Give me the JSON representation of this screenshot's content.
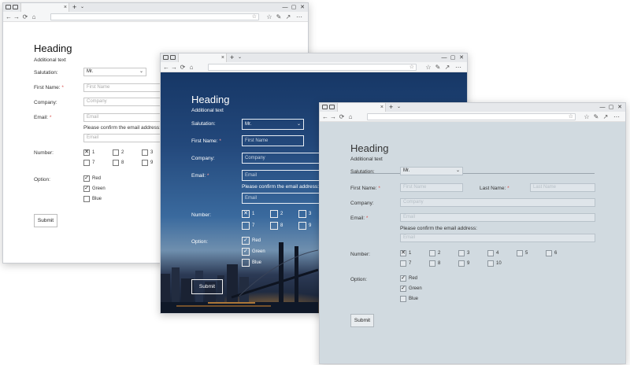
{
  "browser": {
    "tab_close": "×",
    "new_tab": "+",
    "tab_menu": "⌄",
    "window_controls": [
      "—",
      "▢",
      "✕"
    ],
    "nav_icons": [
      "←",
      "→",
      "⟳",
      "⌂"
    ],
    "address_icons": [
      "☆",
      "⋯"
    ]
  },
  "forms": [
    {
      "theme": "default",
      "heading": "Heading",
      "additional": "Additional text",
      "salutation_label": "Salutation:",
      "salutation_value": "Mr.",
      "first_name_label": "First Name:",
      "first_name_placeholder": "First Name",
      "company_label": "Company:",
      "company_placeholder": "Company",
      "email_label": "Email:",
      "email_placeholder": "Email",
      "confirm_label": "Please confirm the email address:",
      "confirm_placeholder": "Email",
      "number_label": "Number:",
      "numbers": [
        {
          "label": "1",
          "checked": true
        },
        {
          "label": "2",
          "checked": false
        },
        {
          "label": "3",
          "checked": false
        },
        {
          "label": "7",
          "checked": false
        },
        {
          "label": "8",
          "checked": false
        },
        {
          "label": "9",
          "checked": false
        }
      ],
      "option_label": "Option:",
      "options": [
        {
          "label": "Red",
          "checked": true
        },
        {
          "label": "Green",
          "checked": true
        },
        {
          "label": "Blue",
          "checked": false
        }
      ],
      "submit": "Submit"
    },
    {
      "theme": "dark-photo",
      "heading": "Heading",
      "additional": "Additional text",
      "salutation_label": "Salutation:",
      "salutation_value": "Mr.",
      "first_name_label": "First Name:",
      "first_name_placeholder": "First Name",
      "company_label": "Company:",
      "company_placeholder": "Company",
      "email_label": "Email:",
      "email_placeholder": "Email",
      "confirm_label": "Please confirm the email address:",
      "confirm_placeholder": "Email",
      "number_label": "Number:",
      "numbers": [
        {
          "label": "1",
          "checked": true
        },
        {
          "label": "2",
          "checked": false
        },
        {
          "label": "3",
          "checked": false
        },
        {
          "label": "7",
          "checked": false
        },
        {
          "label": "8",
          "checked": false
        },
        {
          "label": "9",
          "checked": false
        }
      ],
      "option_label": "Option:",
      "options": [
        {
          "label": "Red",
          "checked": true
        },
        {
          "label": "Green",
          "checked": true
        },
        {
          "label": "Blue",
          "checked": false
        }
      ],
      "submit": "Submit"
    },
    {
      "theme": "gray",
      "heading": "Heading",
      "additional": "Additional text",
      "salutation_label": "Salutation:",
      "salutation_value": "Mr.",
      "first_name_label": "First Name:",
      "first_name_placeholder": "First Name",
      "last_name_label": "Last Name:",
      "last_name_placeholder": "Last Name",
      "company_label": "Company:",
      "company_placeholder": "Company",
      "email_label": "Email:",
      "email_placeholder": "Email",
      "confirm_label": "Please confirm the email address:",
      "confirm_placeholder": "Email",
      "number_label": "Number:",
      "numbers": [
        {
          "label": "1",
          "checked": true
        },
        {
          "label": "2",
          "checked": false
        },
        {
          "label": "3",
          "checked": false
        },
        {
          "label": "4",
          "checked": false
        },
        {
          "label": "5",
          "checked": false
        },
        {
          "label": "6",
          "checked": false
        },
        {
          "label": "7",
          "checked": false
        },
        {
          "label": "8",
          "checked": false
        },
        {
          "label": "9",
          "checked": false
        },
        {
          "label": "10",
          "checked": false
        }
      ],
      "option_label": "Option:",
      "options": [
        {
          "label": "Red",
          "checked": true
        },
        {
          "label": "Green",
          "checked": true
        },
        {
          "label": "Blue",
          "checked": false
        }
      ],
      "submit": "Submit"
    }
  ],
  "colors": {
    "required": "#d9534f",
    "dark_bg_top": "#163766",
    "gray_bg": "#d1dae0"
  }
}
